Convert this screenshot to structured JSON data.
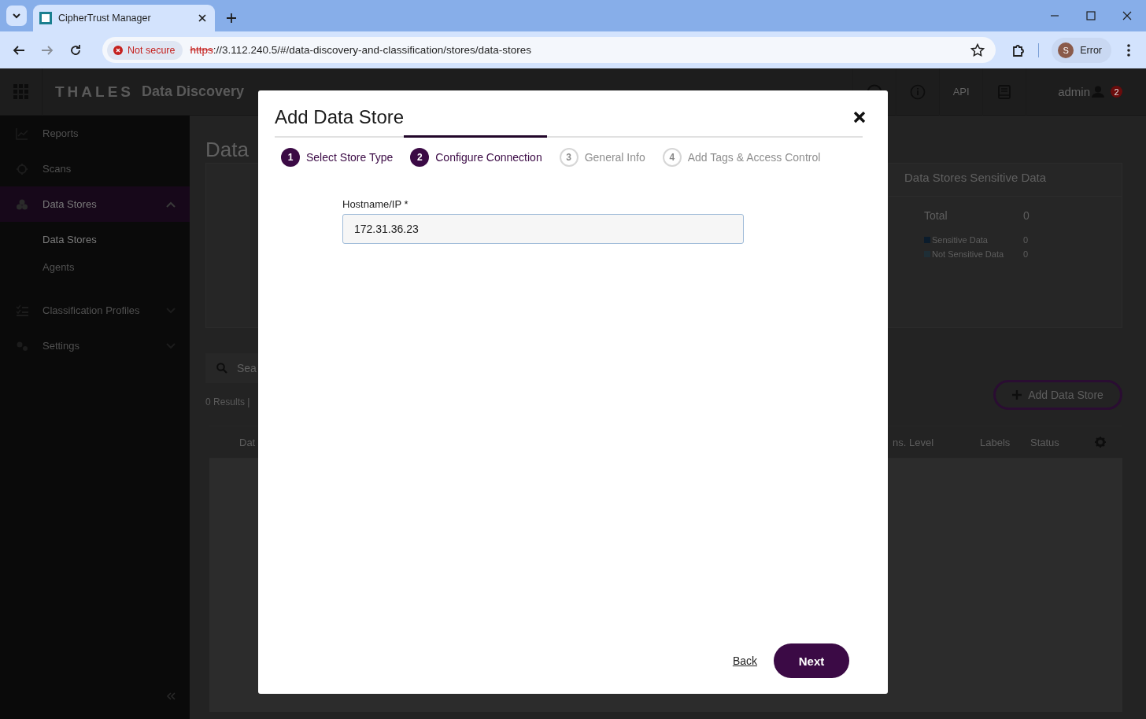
{
  "browser": {
    "tab_title": "CipherTrust Manager",
    "security_label": "Not secure",
    "url_scheme": "https",
    "url_rest": "://3.112.240.5/#/data-discovery-and-classification/stores/data-stores",
    "profile_initial": "S",
    "profile_label": "Error"
  },
  "app_header": {
    "brand": "THALES",
    "product": "Data Discovery",
    "api_label": "API",
    "user": "admin",
    "notification_count": "2"
  },
  "sidebar": {
    "items": [
      {
        "label": "Reports",
        "selected": false
      },
      {
        "label": "Scans",
        "selected": false
      },
      {
        "label": "Data Stores",
        "selected": true,
        "expanded": true,
        "children": [
          {
            "label": "Data Stores",
            "selected": true
          },
          {
            "label": "Agents",
            "selected": false
          }
        ]
      },
      {
        "label": "Classification Profiles",
        "selected": false,
        "expanded": false
      },
      {
        "label": "Settings",
        "selected": false,
        "expanded": false
      }
    ]
  },
  "page": {
    "title": "Data",
    "sensitive_card": {
      "title": "Data Stores Sensitive Data",
      "total_label": "Total",
      "total_value": "0",
      "legend": [
        {
          "label": "Sensitive Data",
          "value": "0",
          "color": "#0b1c2c"
        },
        {
          "label": "Not Sensitive Data",
          "value": "0",
          "color": "#1e2e36"
        }
      ]
    },
    "search": {
      "placeholder": "Sea"
    },
    "results": "0 Results |",
    "add_button": "Add Data Store",
    "table": {
      "columns": [
        "Dat",
        "ns. Level",
        "Labels",
        "Status"
      ]
    }
  },
  "modal": {
    "title": "Add Data Store",
    "steps": [
      {
        "number": "1",
        "label": "Select Store Type",
        "completed": true,
        "selected": false
      },
      {
        "number": "2",
        "label": "Configure Connection",
        "completed": false,
        "selected": true
      },
      {
        "number": "3",
        "label": "General Info",
        "completed": false,
        "selected": false
      },
      {
        "number": "4",
        "label": "Add Tags & Access Control",
        "completed": false,
        "selected": false
      }
    ],
    "field": {
      "label": "Hostname/IP *",
      "value": "172.31.36.23"
    },
    "back": "Back",
    "next": "Next"
  }
}
